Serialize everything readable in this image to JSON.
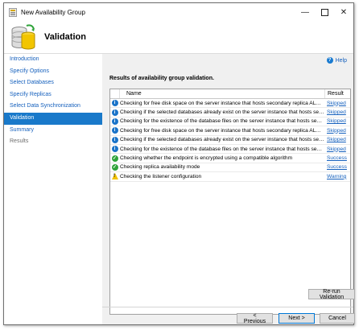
{
  "window": {
    "title": "New Availability Group"
  },
  "header": {
    "title": "Validation"
  },
  "sidebar": {
    "items": [
      {
        "label": "Introduction",
        "state": "link"
      },
      {
        "label": "Specify Options",
        "state": "link"
      },
      {
        "label": "Select Databases",
        "state": "link"
      },
      {
        "label": "Specify Replicas",
        "state": "link"
      },
      {
        "label": "Select Data Synchronization",
        "state": "link"
      },
      {
        "label": "Validation",
        "state": "active"
      },
      {
        "label": "Summary",
        "state": "link"
      },
      {
        "label": "Results",
        "state": "disabled"
      }
    ]
  },
  "help": {
    "label": "Help"
  },
  "main": {
    "heading": "Results of availability group validation.",
    "table": {
      "columns": {
        "name": "Name",
        "result": "Result"
      },
      "rows": [
        {
          "icon": "info",
          "name": "Checking for free disk space on the server instance that hosts secondary replica ALWAYS...",
          "result": "Skipped"
        },
        {
          "icon": "info",
          "name": "Checking if the selected databases already exist on the server instance that hosts second...",
          "result": "Skipped"
        },
        {
          "icon": "info",
          "name": "Checking for the existence of the database files on the server instance that hosts seconda...",
          "result": "Skipped"
        },
        {
          "icon": "info",
          "name": "Checking for free disk space on the server instance that hosts secondary replica ALWAYS...",
          "result": "Skipped"
        },
        {
          "icon": "info",
          "name": "Checking if the selected databases already exist on the server instance that hosts second...",
          "result": "Skipped"
        },
        {
          "icon": "info",
          "name": "Checking for the existence of the database files on the server instance that hosts seconda...",
          "result": "Skipped"
        },
        {
          "icon": "success",
          "name": "Checking whether the endpoint is encrypted using a compatible algorithm",
          "result": "Success"
        },
        {
          "icon": "success",
          "name": "Checking replica availability mode",
          "result": "Success"
        },
        {
          "icon": "warning",
          "name": "Checking the listener configuration",
          "result": "Warning"
        }
      ]
    },
    "rerun_label": "Re-run Validation"
  },
  "footer": {
    "previous_label": "< Previous",
    "next_label": "Next >",
    "cancel_label": "Cancel"
  },
  "icons": {
    "app": "availability-group-icon",
    "header": "database-wizard-icon",
    "info": "info-icon",
    "success": "success-check-icon",
    "warning": "warning-triangle-icon"
  },
  "colors": {
    "accent": "#1979ca",
    "link": "#1560bd",
    "success": "#2fa33a",
    "warning": "#f2c200"
  }
}
